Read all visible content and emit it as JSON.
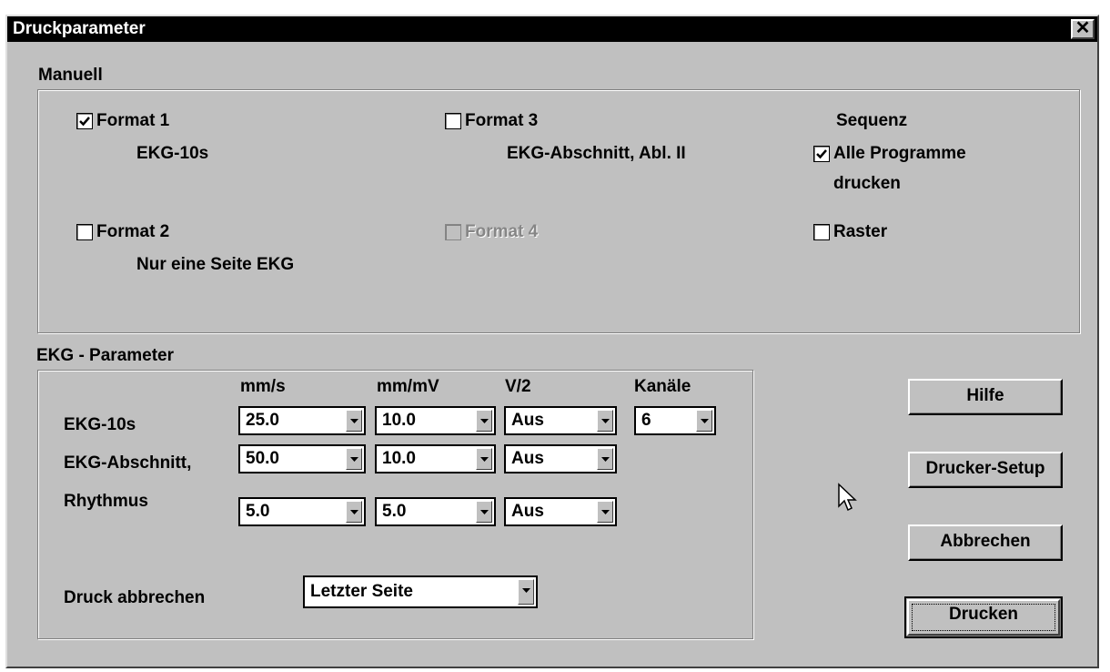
{
  "window": {
    "title": "Druckparameter",
    "close_glyph": "✕"
  },
  "manual": {
    "title": "Manuell",
    "format1": {
      "label": "Format 1",
      "desc": "EKG-10s",
      "checked": true
    },
    "format2": {
      "label": "Format 2",
      "desc": "Nur eine Seite EKG",
      "checked": false
    },
    "format3": {
      "label": "Format 3",
      "desc": "EKG-Abschnitt, Abl. II",
      "checked": false
    },
    "format4": {
      "label": "Format 4",
      "checked": false,
      "disabled": true
    },
    "sequence_title": "Sequenz",
    "print_all": {
      "label_line1": "Alle Programme",
      "label_line2": "drucken",
      "checked": true
    },
    "raster": {
      "label": "Raster",
      "checked": false
    }
  },
  "ekg": {
    "title": "EKG - Parameter",
    "columns": [
      "mm/s",
      "mm/mV",
      "V/2",
      "Kanäle"
    ],
    "rows": [
      {
        "label": "EKG-10s",
        "mms": "25.0",
        "mmmv": "10.0",
        "v2": "Aus",
        "channels": "6"
      },
      {
        "label": "EKG-Abschnitt,",
        "mms": "50.0",
        "mmmv": "10.0",
        "v2": "Aus"
      },
      {
        "label": "Rhythmus",
        "mms": "5.0",
        "mmmv": "5.0",
        "v2": "Aus"
      }
    ],
    "abort_label": "Druck abbrechen",
    "abort_value": "Letzter Seite"
  },
  "buttons": {
    "help": "Hilfe",
    "printer_setup": "Drucker-Setup",
    "cancel": "Abbrechen",
    "print": "Drucken"
  },
  "icons": {
    "checkmark": "checkmark-icon",
    "dropdown": "dropdown-arrow-icon",
    "cursor": "mouse-pointer-icon"
  }
}
